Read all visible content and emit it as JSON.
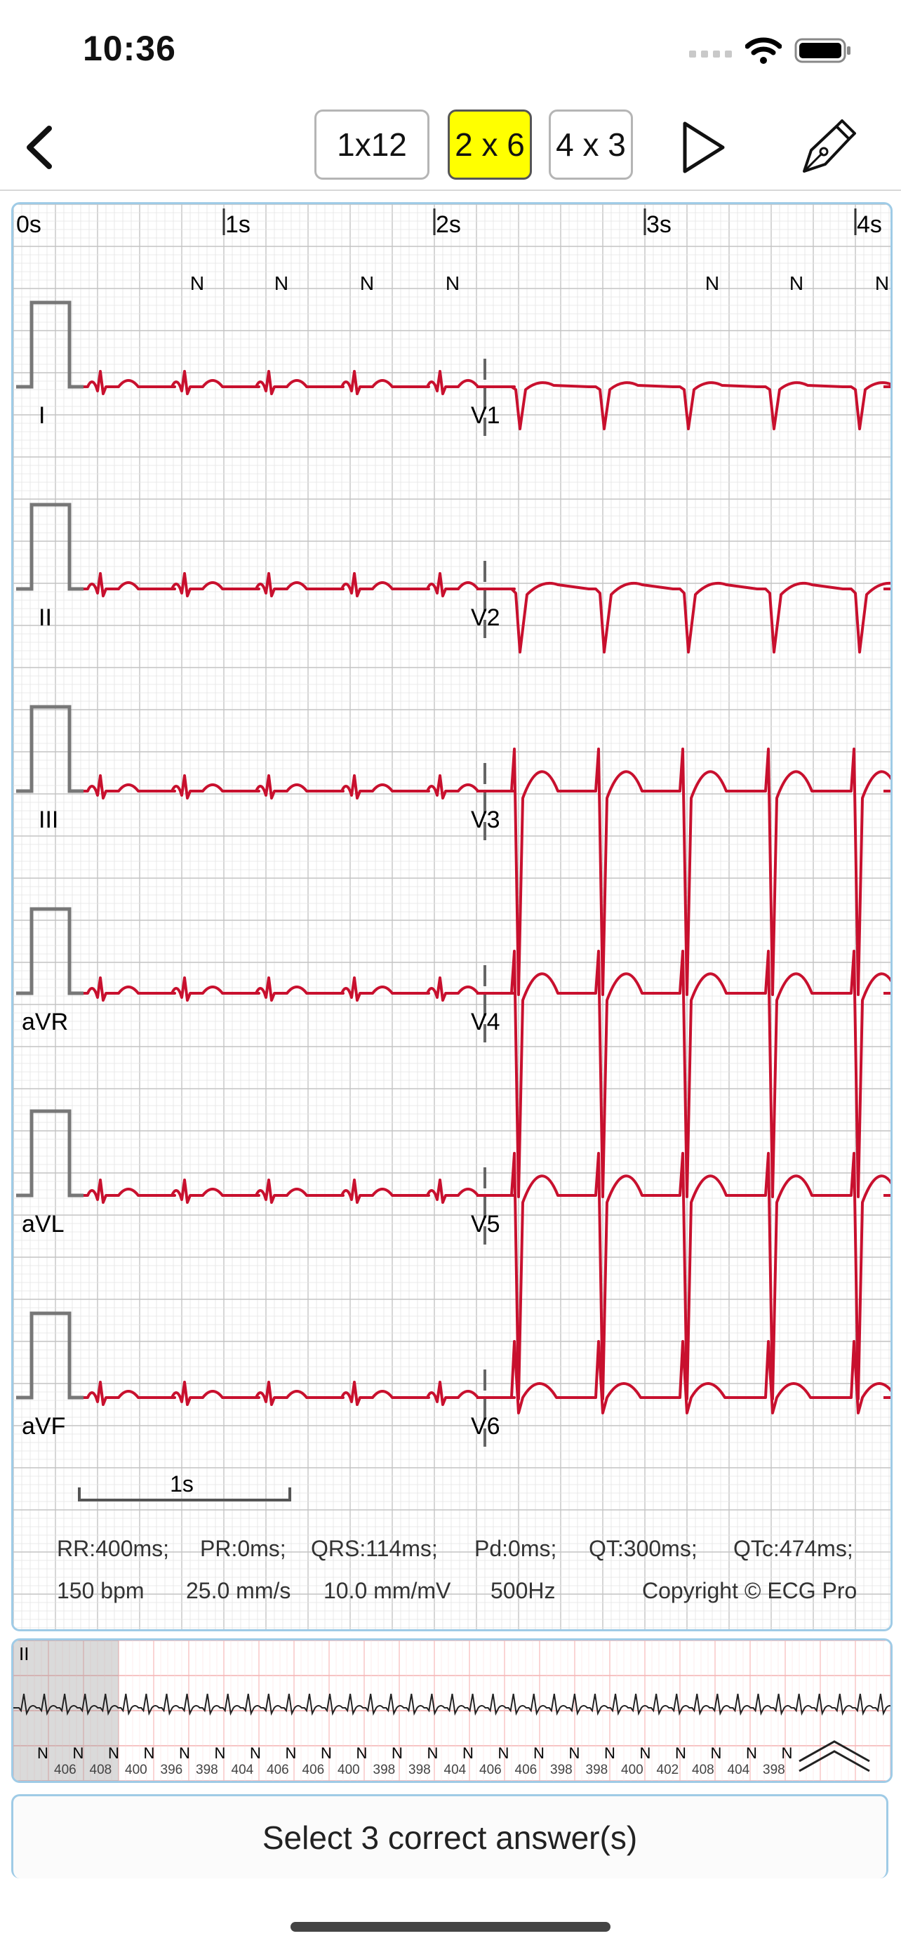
{
  "status": {
    "time": "10:36"
  },
  "toolbar": {
    "layouts": [
      "1x12",
      "2 x 6",
      "4 x 3"
    ],
    "active_layout": "2 x 6"
  },
  "time_axis": [
    "0s",
    "1s",
    "2s",
    "3s",
    "4s"
  ],
  "beat_marker": "N",
  "leads_left": [
    "I",
    "II",
    "III",
    "aVR",
    "aVL",
    "aVF"
  ],
  "leads_right": [
    "V1",
    "V2",
    "V3",
    "V4",
    "V5",
    "V6"
  ],
  "scale_bar": "1s",
  "measurements": {
    "line1": [
      "RR:400ms;",
      "PR:0ms;",
      "QRS:114ms;",
      "Pd:0ms;",
      "QT:300ms;",
      "QTc:474ms;"
    ],
    "line2": [
      "150 bpm",
      "25.0 mm/s",
      "10.0 mm/mV",
      "500Hz"
    ],
    "copyright": "Copyright © ECG Pro"
  },
  "rhythm": {
    "lead": "II",
    "rr_intervals": [
      "406",
      "408",
      "400",
      "396",
      "398",
      "404",
      "406",
      "406",
      "400",
      "398",
      "398",
      "404",
      "406",
      "406",
      "398",
      "398",
      "400",
      "402",
      "408",
      "404",
      "398"
    ]
  },
  "question": {
    "prompt": "Select 3 correct answer(s)"
  },
  "colors": {
    "trace": "#c8102e",
    "active_segment": "#ffff00",
    "grid_fine": "#e4e4e4",
    "grid_major": "#c4c4c4",
    "rhythm_grid": "#f2a0a0",
    "panel_border": "#9fcbe6"
  }
}
